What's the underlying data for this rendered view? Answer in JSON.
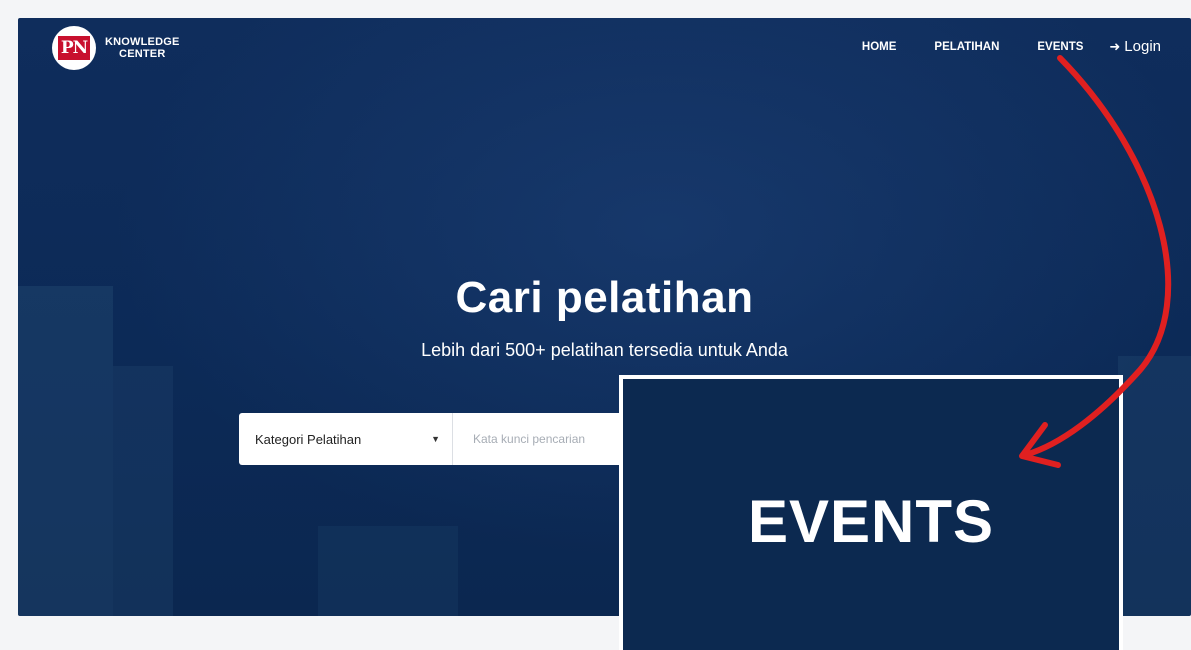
{
  "header": {
    "logo_mark": "PN",
    "logo_line1": "KNOWLEDGE",
    "logo_line2": "CENTER",
    "nav": [
      "HOME",
      "PELATIHAN",
      "EVENTS"
    ],
    "login_label": "Login"
  },
  "hero": {
    "title": "Cari pelatihan",
    "subtitle": "Lebih dari 500+ pelatihan tersedia untuk Anda"
  },
  "search": {
    "category_label": "Kategori Pelatihan",
    "placeholder": "Kata kunci pencarian"
  },
  "callout": {
    "zoom_text": "EVENTS",
    "arrow_color": "#e02020"
  },
  "colors": {
    "hero_bg": "#0f2d5c",
    "brand_red": "#c8102e"
  },
  "icons": {
    "login": "sign-in-icon",
    "dropdown": "caret-down-icon"
  }
}
